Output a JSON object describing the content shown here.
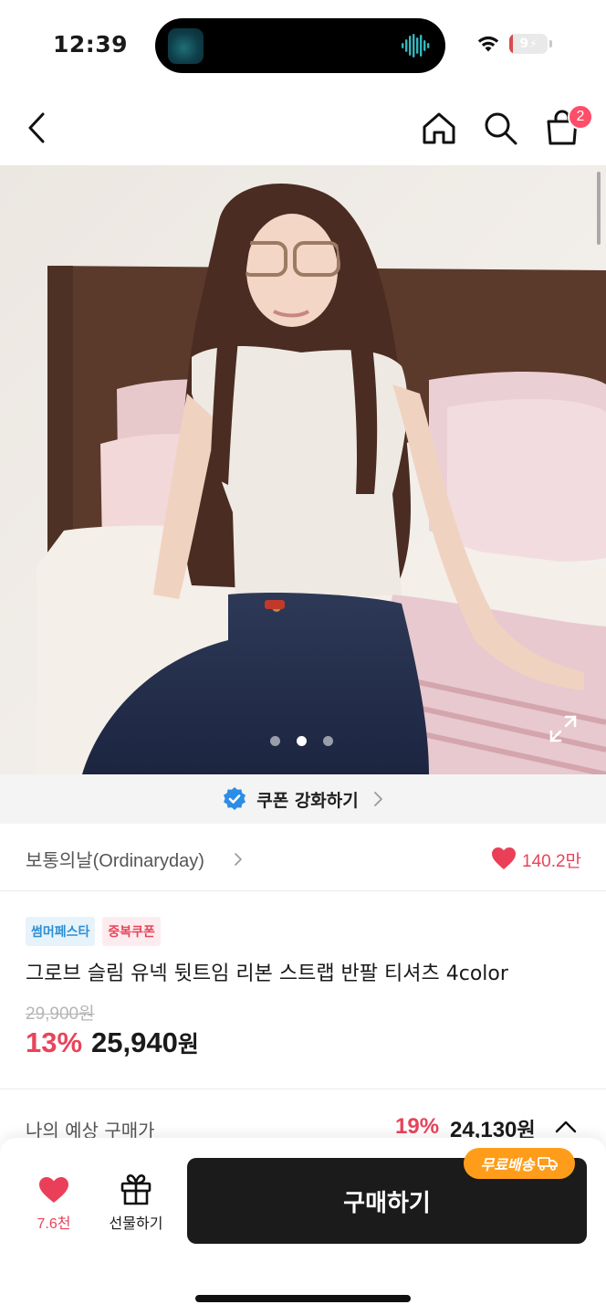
{
  "status_bar": {
    "time": "12:39",
    "battery_level": "9",
    "battery_fraction": 0.09,
    "battery_color": "#d94a4a"
  },
  "nav": {
    "back_icon": "chevron-left-icon",
    "home_icon": "home-icon",
    "search_icon": "search-icon",
    "cart_icon": "shopping-bag-icon",
    "cart_badge": "2",
    "badge_color": "#ff4d6a"
  },
  "gallery": {
    "total_images": 3,
    "active_index": 1,
    "expand_icon": "expand-icon"
  },
  "coupon": {
    "label": "쿠폰 강화하기",
    "icon": "verified-check-icon"
  },
  "brand": {
    "name": "보통의날(Ordinaryday)",
    "likes": "140.2만"
  },
  "product": {
    "tags": [
      "썸머페스타",
      "중복쿠폰"
    ],
    "title": "그로브 슬림 유넥 뒷트임 리본 스트랩 반팔 티셔츠 4color",
    "original_price": "29,900원",
    "discount_rate": "13%",
    "sale_price": "25,940",
    "price_unit": "원"
  },
  "expected_price": {
    "label": "나의 예상 구매가",
    "discount_rate": "19%",
    "price": "24,130",
    "unit": "원"
  },
  "bottom_bar": {
    "wish_count": "7.6천",
    "gift_label": "선물하기",
    "buy_label": "구매하기",
    "free_shipping_label": "무료배송"
  },
  "colors": {
    "accent_pink": "#e8445a",
    "buy_button": "#1b1b1b",
    "free_ship_orange": "#ff9d1a",
    "festa_tag_blue": "#2d8fd4"
  }
}
